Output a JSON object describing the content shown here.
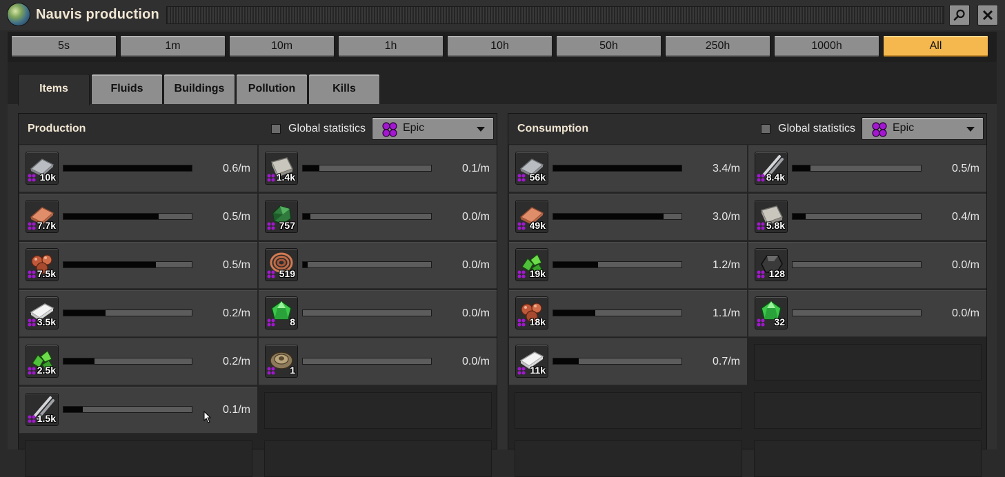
{
  "window": {
    "title": "Nauvis production"
  },
  "time_buttons": [
    "5s",
    "1m",
    "10m",
    "1h",
    "10h",
    "50h",
    "250h",
    "1000h",
    "All"
  ],
  "active_time": "All",
  "tabs": [
    "Items",
    "Fluids",
    "Buildings",
    "Pollution",
    "Kills"
  ],
  "active_tab": "Items",
  "production": {
    "title": "Production",
    "global_label": "Global statistics",
    "quality": "Epic",
    "cells": [
      {
        "icon": "iron-plate-icon",
        "count": "10k",
        "rate": "0.6/m",
        "level": 1.0
      },
      {
        "icon": "stone-brick-icon",
        "count": "1.4k",
        "rate": "0.1/m",
        "level": 0.13
      },
      {
        "icon": "copper-plate-icon",
        "count": "7.7k",
        "rate": "0.5/m",
        "level": 0.74
      },
      {
        "icon": "green-crystal-icon",
        "count": "757",
        "rate": "0.0/m",
        "level": 0.06
      },
      {
        "icon": "copper-ore-icon",
        "count": "7.5k",
        "rate": "0.5/m",
        "level": 0.72
      },
      {
        "icon": "copper-cable-icon",
        "count": "519",
        "rate": "0.0/m",
        "level": 0.04
      },
      {
        "icon": "plastic-bar-icon",
        "count": "3.5k",
        "rate": "0.2/m",
        "level": 0.33
      },
      {
        "icon": "green-gem-icon",
        "count": "8",
        "rate": "0.0/m",
        "level": 0
      },
      {
        "icon": "green-ore-icon",
        "count": "2.5k",
        "rate": "0.2/m",
        "level": 0.24
      },
      {
        "icon": "landmine-icon",
        "count": "1",
        "rate": "0.0/m",
        "level": 0
      },
      {
        "icon": "iron-stick-icon",
        "count": "1.5k",
        "rate": "0.1/m",
        "level": 0.15
      }
    ]
  },
  "consumption": {
    "title": "Consumption",
    "global_label": "Global statistics",
    "quality": "Epic",
    "cells": [
      {
        "icon": "iron-plate-icon",
        "count": "56k",
        "rate": "3.4/m",
        "level": 1.0
      },
      {
        "icon": "iron-stick-icon",
        "count": "8.4k",
        "rate": "0.5/m",
        "level": 0.14
      },
      {
        "icon": "copper-plate-icon",
        "count": "49k",
        "rate": "3.0/m",
        "level": 0.86
      },
      {
        "icon": "stone-brick-icon",
        "count": "5.8k",
        "rate": "0.4/m",
        "level": 0.1
      },
      {
        "icon": "green-ore-icon",
        "count": "19k",
        "rate": "1.2/m",
        "level": 0.35
      },
      {
        "icon": "coal-icon",
        "count": "128",
        "rate": "0.0/m",
        "level": 0
      },
      {
        "icon": "copper-ore-icon",
        "count": "18k",
        "rate": "1.1/m",
        "level": 0.33
      },
      {
        "icon": "green-gem-icon",
        "count": "32",
        "rate": "0.0/m",
        "level": 0
      },
      {
        "icon": "plastic-bar-icon",
        "count": "11k",
        "rate": "0.7/m",
        "level": 0.2
      }
    ]
  },
  "colors": {
    "accent": "#f5b84f",
    "epic": "#a317d1",
    "button": "#8e8e8e"
  }
}
